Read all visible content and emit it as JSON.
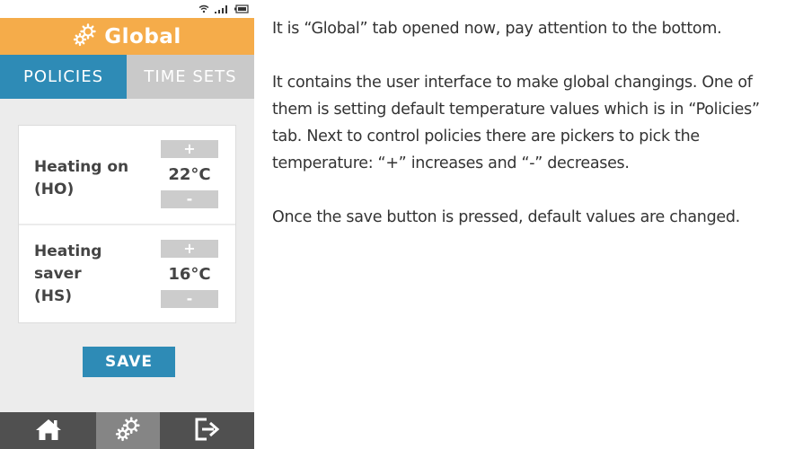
{
  "app": {
    "title": "Global"
  },
  "tabs": [
    {
      "label": "POLICIES",
      "active": true
    },
    {
      "label": "TIME SETS",
      "active": false
    }
  ],
  "policies": [
    {
      "label_lines": [
        "Heating on",
        "(HO)"
      ],
      "value": "22°C",
      "increase_label": "+",
      "decrease_label": "-"
    },
    {
      "label_lines": [
        "Heating",
        "saver",
        "(HS)"
      ],
      "value": "16°C",
      "increase_label": "+",
      "decrease_label": "-"
    }
  ],
  "save_label": "SAVE",
  "bottom_nav": {
    "items": [
      {
        "icon": "home-icon",
        "active": false
      },
      {
        "icon": "settings-gears-icon",
        "active": true
      },
      {
        "icon": "logout-icon",
        "active": false
      }
    ]
  },
  "status_bar": {
    "icons": [
      "wifi-icon",
      "signal-icon",
      "battery-icon"
    ]
  },
  "description": {
    "paragraphs": [
      "It is “Global” tab opened now, pay attention to the bottom.",
      "It contains the user interface to make global changings. One of them is setting default temperature values which is in “Policies” tab. Next to control policies there are pickers to pick the temperature: “+” increases and “-” decreases.",
      "Once the save button is pressed, default values are changed."
    ]
  },
  "colors": {
    "title_bar": "#f5ac4a",
    "accent_blue": "#2e8bb6",
    "inactive_tab": "#c9c9c9",
    "bottom_nav": "#505050",
    "bottom_nav_active": "#858585"
  }
}
